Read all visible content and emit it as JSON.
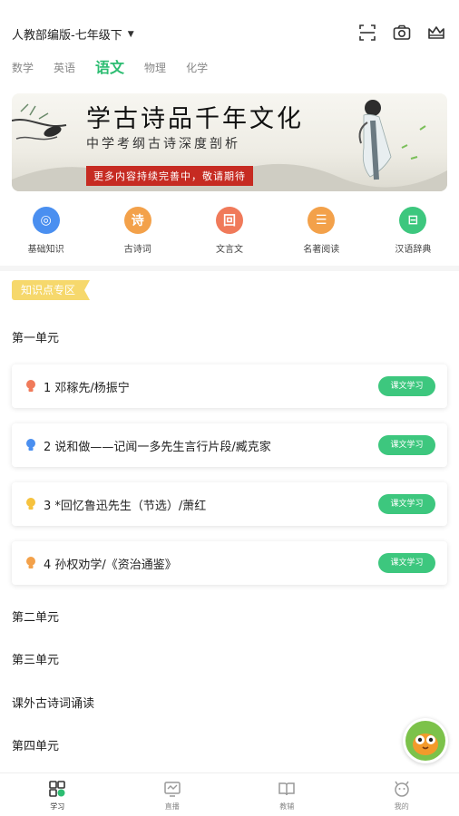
{
  "header": {
    "grade_label": "人教部编版-七年级下",
    "icons": [
      "scan-icon",
      "camera-icon",
      "crown-icon"
    ]
  },
  "subjects": [
    {
      "label": "数学",
      "active": false
    },
    {
      "label": "英语",
      "active": false
    },
    {
      "label": "语文",
      "active": true
    },
    {
      "label": "物理",
      "active": false
    },
    {
      "label": "化学",
      "active": false
    }
  ],
  "banner": {
    "title": "学古诗品千年文化",
    "subtitle": "中学考纲古诗深度剖析",
    "notice": "更多内容持续完善中，敬请期待"
  },
  "quick_links": [
    {
      "label": "基础知识",
      "icon": "compass-icon",
      "color": "#4a8ff0",
      "glyph": "◎"
    },
    {
      "label": "古诗词",
      "icon": "poem-icon",
      "color": "#f3a14a",
      "glyph": "诗"
    },
    {
      "label": "文言文",
      "icon": "classical-text-icon",
      "color": "#f07a5a",
      "glyph": "回"
    },
    {
      "label": "名著阅读",
      "icon": "reading-icon",
      "color": "#f3a14a",
      "glyph": "☰"
    },
    {
      "label": "汉语辞典",
      "icon": "dictionary-icon",
      "color": "#3dc77e",
      "glyph": "⊟"
    }
  ],
  "section_tag": "知识点专区",
  "units": [
    {
      "title": "第一单元"
    },
    {
      "title": "第二单元"
    },
    {
      "title": "第三单元"
    },
    {
      "title": "课外古诗词诵读"
    },
    {
      "title": "第四单元"
    }
  ],
  "lessons": [
    {
      "text": "1 邓稼先/杨振宁",
      "bulb_color": "#f07a5a",
      "button": "课文学习"
    },
    {
      "text": "2 说和做——记闻一多先生言行片段/臧克家",
      "bulb_color": "#4a8ff0",
      "button": "课文学习"
    },
    {
      "text": "3 *回忆鲁迅先生（节选）/萧红",
      "bulb_color": "#f6c23e",
      "button": "课文学习"
    },
    {
      "text": "4 孙权劝学/《资治通鉴》",
      "bulb_color": "#f3a14a",
      "button": "课文学习"
    }
  ],
  "tabbar": [
    {
      "label": "学习",
      "icon": "study-icon",
      "active": true
    },
    {
      "label": "直播",
      "icon": "live-icon",
      "active": false
    },
    {
      "label": "教辅",
      "icon": "book-icon",
      "active": false
    },
    {
      "label": "我的",
      "icon": "profile-icon",
      "active": false
    }
  ],
  "colors": {
    "accent": "#2dbd72",
    "button": "#3dc77e",
    "tag": "#f6d86c"
  }
}
